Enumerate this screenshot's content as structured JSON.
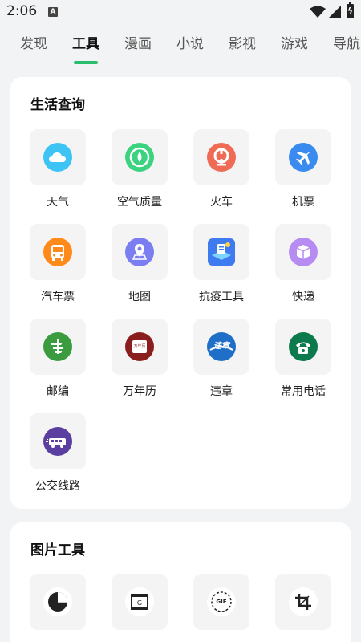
{
  "status_bar": {
    "time": "2:06",
    "notification_icon": "A"
  },
  "tabs": [
    {
      "label": "发现"
    },
    {
      "label": "工具",
      "active": true
    },
    {
      "label": "漫画"
    },
    {
      "label": "小说"
    },
    {
      "label": "影视"
    },
    {
      "label": "游戏"
    },
    {
      "label": "导航"
    }
  ],
  "sections": {
    "life": {
      "title": "生活查询",
      "items": [
        {
          "label": "天气",
          "icon": "weather-icon",
          "color": "#3ec3f5"
        },
        {
          "label": "空气质量",
          "icon": "air-quality-icon",
          "color": "#3bd37f"
        },
        {
          "label": "火车",
          "icon": "train-icon",
          "color": "#f06b55"
        },
        {
          "label": "机票",
          "icon": "plane-icon",
          "color": "#3a8bf0"
        },
        {
          "label": "汽车票",
          "icon": "bus-icon",
          "color": "#ff8a1c"
        },
        {
          "label": "地图",
          "icon": "map-icon",
          "color": "#7a7ef0"
        },
        {
          "label": "抗疫工具",
          "icon": "epidemic-tools-icon",
          "color": "#3f7bf0"
        },
        {
          "label": "快递",
          "icon": "package-icon",
          "color": "#b78cf2"
        },
        {
          "label": "邮编",
          "icon": "postal-icon",
          "color": "#3a9c3e"
        },
        {
          "label": "万年历",
          "icon": "calendar-icon",
          "color": "#8a1d1d",
          "badge": "万年历"
        },
        {
          "label": "违章",
          "icon": "violation-icon",
          "color": "#1f6fc9",
          "badge": "违章"
        },
        {
          "label": "常用电话",
          "icon": "phone-icon",
          "color": "#0d7a4e"
        },
        {
          "label": "公交线路",
          "icon": "bus-route-icon",
          "color": "#5a3ea0"
        }
      ]
    },
    "image": {
      "title": "图片工具",
      "items": [
        {
          "label": "",
          "icon": "pie-chart-icon",
          "color": "#222222"
        },
        {
          "label": "",
          "icon": "film-icon",
          "color": "#222222"
        },
        {
          "label": "",
          "icon": "gif-icon",
          "color": "#222222",
          "badge": "GIF"
        },
        {
          "label": "",
          "icon": "crop-icon",
          "color": "#222222"
        }
      ]
    }
  }
}
